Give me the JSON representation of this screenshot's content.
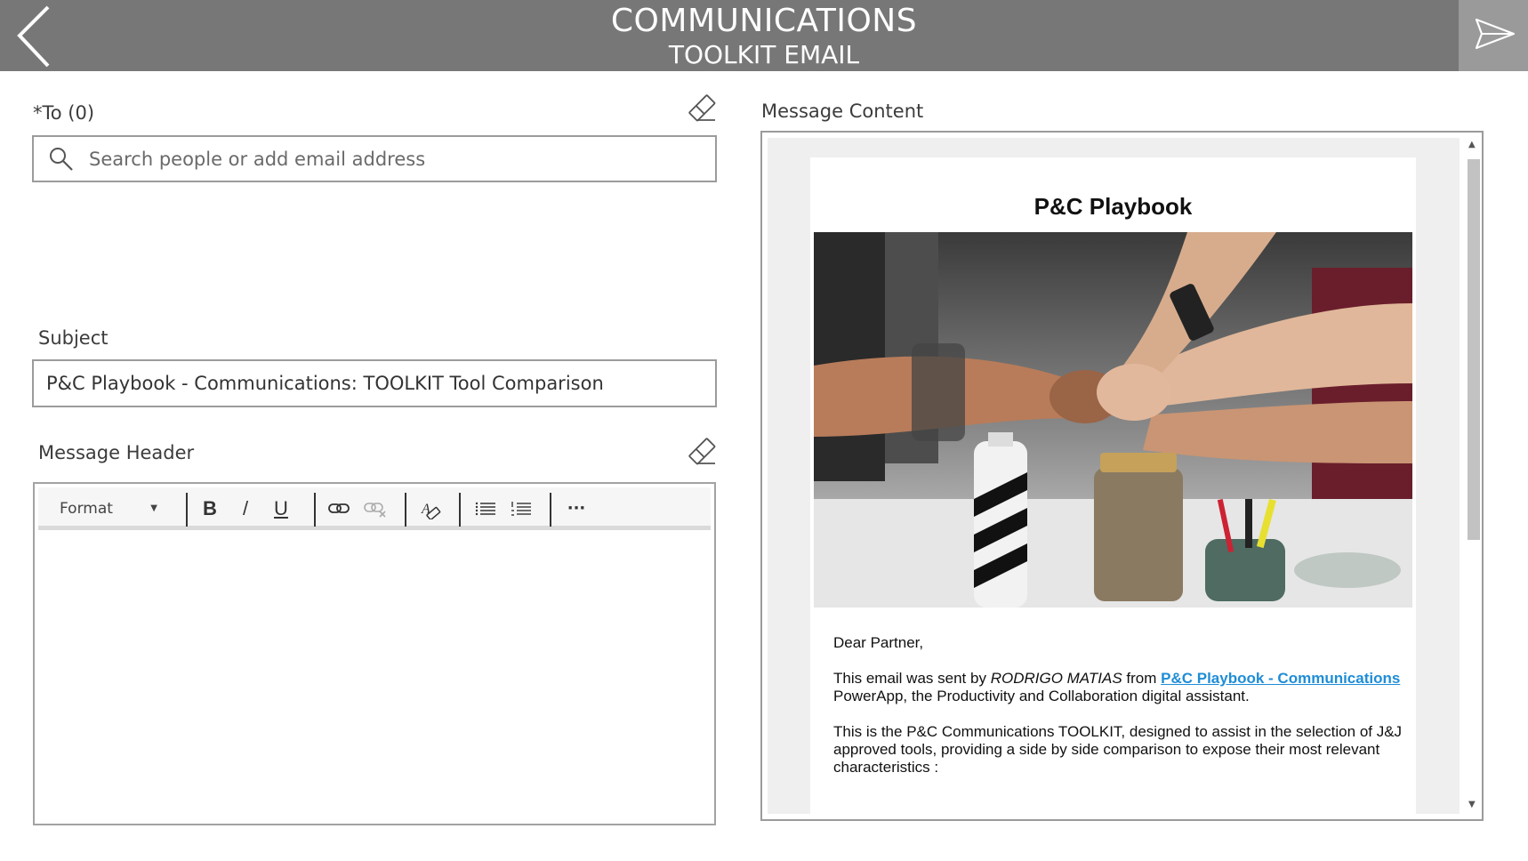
{
  "header": {
    "title": "COMMUNICATIONS",
    "subtitle": "TOOLKIT EMAIL",
    "back_icon": "chevron-left-icon",
    "send_icon": "send-icon",
    "background_color": "#777777"
  },
  "to": {
    "label": "*To (0)",
    "placeholder": "Search people or add email address",
    "value": ""
  },
  "subject": {
    "label": "Subject",
    "value": "P&C Playbook - Communications: TOOLKIT Tool Comparison"
  },
  "message_header": {
    "label": "Message Header",
    "toolbar": {
      "format_label": "Format",
      "bold": "B",
      "italic": "/",
      "underline": "U",
      "more": "···"
    }
  },
  "message_content": {
    "label": "Message Content",
    "card_title": "P&C Playbook",
    "greeting": "Dear Partner,",
    "sent_by_prefix": "This email was sent by ",
    "sender": "RODRIGO MATIAS",
    "from_word": " from ",
    "app_link": "P&C Playbook - Communications",
    "sent_by_suffix": " PowerApp, the Productivity and Collaboration digital assistant.",
    "body": "This is the P&C Communications TOOLKIT, designed to assist in the selection of J&J approved tools, providing a side by side comparison to expose their most relevant characteristics :"
  },
  "colors": {
    "link": "#1f8dd6",
    "border": "#9b9b9b"
  }
}
